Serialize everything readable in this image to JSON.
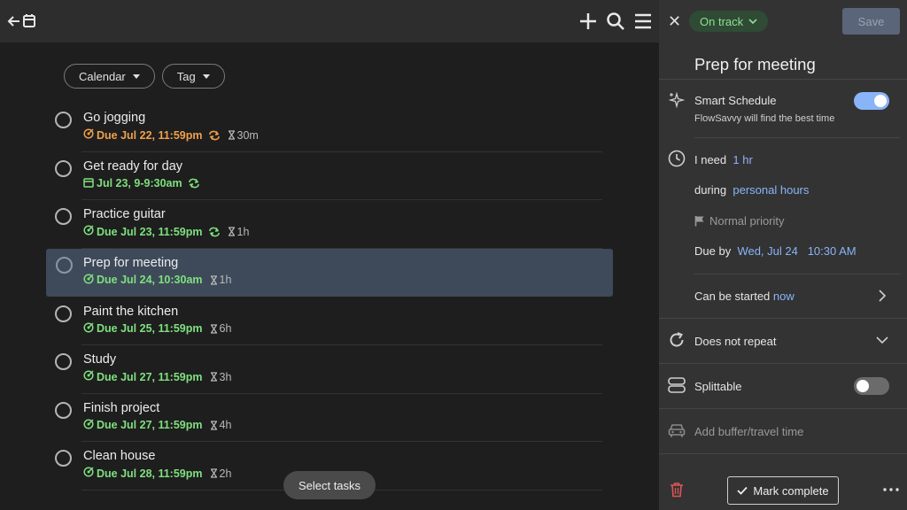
{
  "colors": {
    "accent": "#8ab4f8",
    "due_overdue": "#f0a04b",
    "due_ok": "#7ee07e",
    "selected_row": "#3e4a5a"
  },
  "filters": [
    {
      "label": "Calendar"
    },
    {
      "label": "Tag"
    }
  ],
  "tasks": [
    {
      "title": "Go jogging",
      "due": "Due Jul 22, 11:59pm",
      "due_icon": "target-icon",
      "color": "#f0a04b",
      "repeat": true,
      "duration": "30m"
    },
    {
      "title": "Get ready for day",
      "due": "Jul 23, 9-9:30am",
      "due_icon": "calendar-icon",
      "color": "#7ee07e",
      "repeat": true,
      "duration": ""
    },
    {
      "title": "Practice guitar",
      "due": "Due Jul 23, 11:59pm",
      "due_icon": "target-icon",
      "color": "#7ee07e",
      "repeat": true,
      "duration": "1h"
    },
    {
      "title": "Prep for meeting",
      "due": "Due Jul 24, 10:30am",
      "due_icon": "target-icon",
      "color": "#7ee07e",
      "repeat": false,
      "duration": "1h",
      "selected": true
    },
    {
      "title": "Paint the kitchen",
      "due": "Due Jul 25, 11:59pm",
      "due_icon": "target-icon",
      "color": "#7ee07e",
      "repeat": false,
      "duration": "6h"
    },
    {
      "title": "Study",
      "due": "Due Jul 27, 11:59pm",
      "due_icon": "target-icon",
      "color": "#7ee07e",
      "repeat": false,
      "duration": "3h"
    },
    {
      "title": "Finish project",
      "due": "Due Jul 27, 11:59pm",
      "due_icon": "target-icon",
      "color": "#7ee07e",
      "repeat": false,
      "duration": "4h"
    },
    {
      "title": "Clean house",
      "due": "Due Jul 28, 11:59pm",
      "due_icon": "target-icon",
      "color": "#7ee07e",
      "repeat": false,
      "duration": "2h"
    }
  ],
  "select_tasks_label": "Select tasks",
  "panel": {
    "status": "On track",
    "save_label": "Save",
    "title": "Prep for meeting",
    "smart_schedule": {
      "label": "Smart Schedule",
      "sub": "FlowSavvy will find the best time",
      "on": true
    },
    "need_label": "I need",
    "need_value": "1 hr",
    "during_label": "during",
    "during_value": "personal hours",
    "priority": "Normal priority",
    "due_by_label": "Due by",
    "due_date": "Wed, Jul 24",
    "due_time": "10:30 AM",
    "start_label": "Can be started",
    "start_value": "now",
    "repeat": "Does not repeat",
    "splittable": {
      "label": "Splittable",
      "on": false
    },
    "buffer": "Add buffer/travel time",
    "mark_complete": "Mark complete"
  }
}
